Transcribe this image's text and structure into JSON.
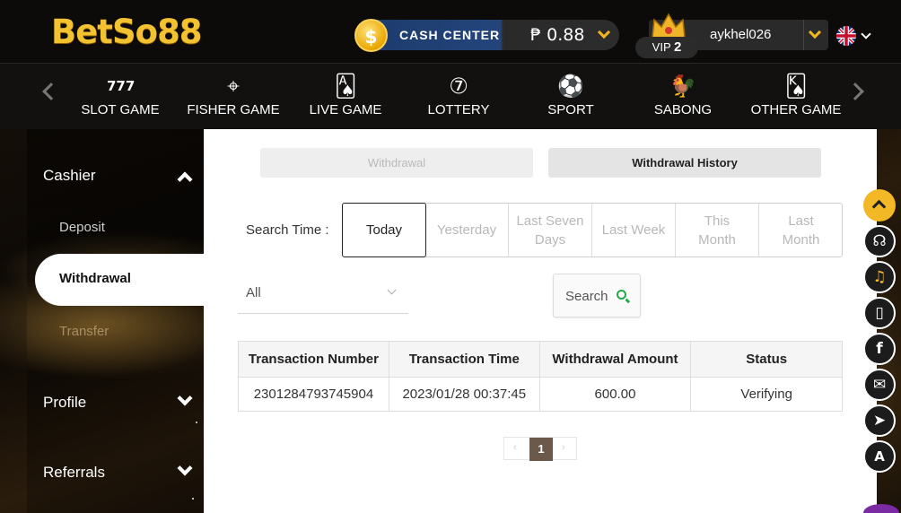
{
  "brand": {
    "logo_prefix": "BetSo",
    "logo_suffix": "88"
  },
  "header": {
    "cash_center_label": "CASH CENTER",
    "balance": "₱ 0.88",
    "username": "aykhel026",
    "vip_label": "VIP",
    "vip_level": "2",
    "language_icon": "uk-flag-icon"
  },
  "nav": {
    "items": [
      {
        "label": "SLOT GAME",
        "icon": "slot-icon",
        "glyph": "777"
      },
      {
        "label": "FISHER GAME",
        "icon": "crosshair-icon",
        "glyph": "⌖"
      },
      {
        "label": "LIVE GAME",
        "icon": "live-cards-icon",
        "glyph": "🂡"
      },
      {
        "label": "LOTTERY",
        "icon": "lottery-ball-icon",
        "glyph": "⑦"
      },
      {
        "label": "SPORT",
        "icon": "soccer-ball-icon",
        "glyph": "⚽"
      },
      {
        "label": "SABONG",
        "icon": "rooster-icon",
        "glyph": "🐓"
      },
      {
        "label": "OTHER GAME",
        "icon": "cards-icon",
        "glyph": "🂮"
      }
    ]
  },
  "sidebar": {
    "cashier": "Cashier",
    "deposit": "Deposit",
    "withdrawal": "Withdrawal",
    "transfer": "Transfer",
    "profile": "Profile",
    "referrals": "Referrals"
  },
  "tabs": {
    "withdrawal": "Withdrawal",
    "history": "Withdrawal History"
  },
  "search": {
    "time_label": "Search Time :",
    "options": [
      "Today",
      "Yesterday",
      "Last Seven Days",
      "Last Week",
      "This Month",
      "Last Month"
    ],
    "selected": "Today",
    "status_filter": "All",
    "button": "Search"
  },
  "table": {
    "headers": [
      "Transaction Number",
      "Transaction Time",
      "Withdrawal Amount",
      "Status"
    ],
    "rows": [
      [
        "2301284793745904",
        "2023/01/28 00:37:45",
        "600.00",
        "Verifying"
      ]
    ]
  },
  "pagination": {
    "current": "1",
    "prev": "‹",
    "next": "›"
  },
  "floating": {
    "icons": [
      "scroll-top-icon",
      "headset-icon",
      "bell-icon",
      "mobile-icon",
      "facebook-icon",
      "messenger-icon",
      "telegram-icon",
      "app-icon"
    ]
  },
  "colors": {
    "accent": "#f2b825",
    "cash_blue": "#23457c",
    "search_green": "#23a94a"
  }
}
